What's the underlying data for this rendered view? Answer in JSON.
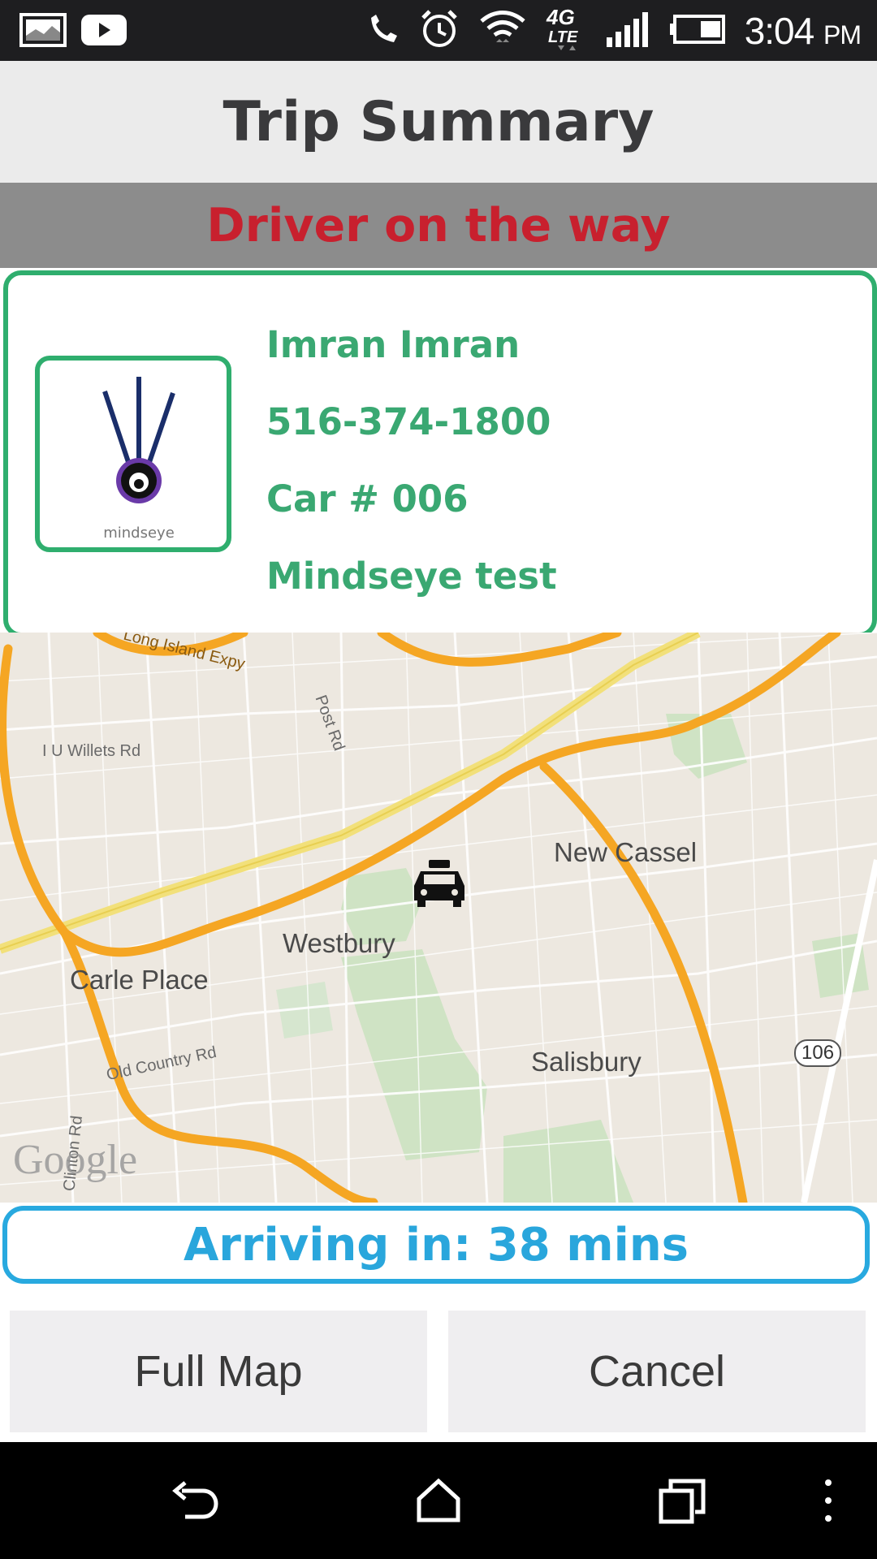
{
  "status_bar": {
    "time": "3:04",
    "ampm": "PM",
    "network": "4G LTE",
    "icons": [
      "gallery-icon",
      "youtube-icon",
      "phone-icon",
      "alarm-icon",
      "wifi-icon",
      "lte-icon",
      "signal-icon",
      "battery-icon"
    ]
  },
  "header": {
    "title": "Trip Summary"
  },
  "status_banner": {
    "text": "Driver on the way",
    "color": "#c8202e"
  },
  "driver": {
    "name": "Imran Imran",
    "phone": "516-374-1800",
    "car": "Car # 006",
    "company": "Mindseye test",
    "photo_caption": "mindseye"
  },
  "map": {
    "places": [
      "New Cassel",
      "Westbury",
      "Carle Place",
      "Salisbury"
    ],
    "roads": [
      "Long Island Expy",
      "Post Rd",
      "I U Willets Rd",
      "Old Country Rd",
      "Clinton Rd"
    ],
    "route_shield": "106",
    "attribution": "Google",
    "marker": "taxi-icon"
  },
  "eta": {
    "text": "Arriving in: 38 mins",
    "color": "#29a6dc"
  },
  "buttons": {
    "full_map": "Full Map",
    "cancel": "Cancel"
  },
  "colors": {
    "accent_green": "#2fae6e",
    "accent_blue": "#28a9df",
    "alert_red": "#c8202e"
  }
}
